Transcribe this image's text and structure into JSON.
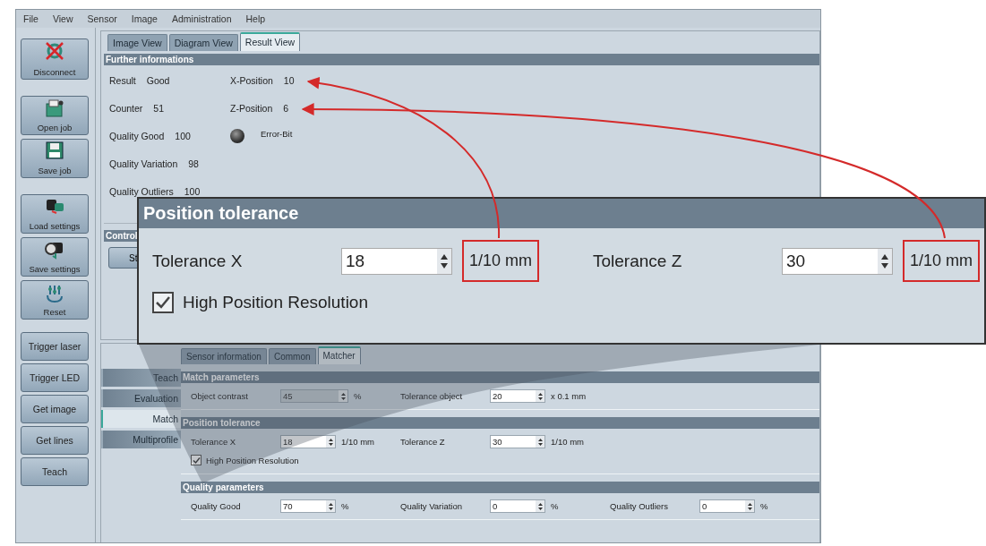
{
  "menu": [
    "File",
    "View",
    "Sensor",
    "Image",
    "Administration",
    "Help"
  ],
  "sidebar": {
    "buttons": [
      {
        "label": "Disconnect",
        "kind": "disconnect"
      },
      {
        "label": "Open job",
        "kind": "open"
      },
      {
        "label": "Save job",
        "kind": "save"
      },
      {
        "label": "Load settings",
        "kind": "load"
      },
      {
        "label": "Save settings",
        "kind": "store"
      },
      {
        "label": "Reset",
        "kind": "reset"
      },
      {
        "label": "Trigger laser",
        "kind": "text"
      },
      {
        "label": "Trigger LED",
        "kind": "text"
      },
      {
        "label": "Get image",
        "kind": "text"
      },
      {
        "label": "Get lines",
        "kind": "text"
      },
      {
        "label": "Teach",
        "kind": "text"
      }
    ]
  },
  "top_tabs": [
    {
      "label": "Image View",
      "selected": false
    },
    {
      "label": "Diagram View",
      "selected": false
    },
    {
      "label": "Result View",
      "selected": true
    }
  ],
  "further_info": {
    "title": "Further informations",
    "left_rows": [
      {
        "label": "Result",
        "value": "Good"
      },
      {
        "label": "Counter",
        "value": "51"
      },
      {
        "label": "Quality Good",
        "value": "100"
      },
      {
        "label": "Quality Variation",
        "value": "98"
      },
      {
        "label": "Quality Outliers",
        "value": "100"
      }
    ],
    "right_rows": [
      {
        "label": "X-Position",
        "value": "10"
      },
      {
        "label": "Z-Position",
        "value": "6"
      }
    ],
    "error_bit": {
      "label": "Error-Bit"
    }
  },
  "control": {
    "title": "Control",
    "button": "St"
  },
  "side_tabs": [
    {
      "label": "Teach",
      "selected": false
    },
    {
      "label": "Evaluation",
      "selected": false
    },
    {
      "label": "Match",
      "selected": true
    },
    {
      "label": "Multiprofile",
      "selected": false
    }
  ],
  "bottom_tabs": [
    {
      "label": "Sensor information",
      "selected": false
    },
    {
      "label": "Common",
      "selected": false
    },
    {
      "label": "Matcher",
      "selected": true
    }
  ],
  "sections": [
    {
      "title": "Match parameters",
      "rows": [
        {
          "kind": "fields",
          "fields": [
            {
              "label": "Object contrast",
              "value": "45",
              "unit": "%",
              "disabled": true
            },
            {
              "label": "Tolerance object",
              "value": "20",
              "unit": "x 0.1 mm",
              "disabled": false
            }
          ]
        }
      ]
    },
    {
      "title": "Position tolerance",
      "rows": [
        {
          "kind": "fields",
          "fields": [
            {
              "label": "Tolerance X",
              "value": "18",
              "unit": "1/10 mm",
              "disabled": false
            },
            {
              "label": "Tolerance Z",
              "value": "30",
              "unit": "1/10 mm",
              "disabled": false
            }
          ]
        },
        {
          "kind": "checkbox",
          "label": "High Position Resolution",
          "checked": true
        }
      ]
    },
    {
      "title": "Quality parameters",
      "rows": [
        {
          "kind": "fields",
          "fields": [
            {
              "label": "Quality Good",
              "value": "70",
              "unit": "%",
              "disabled": false
            },
            {
              "label": "Quality Variation",
              "value": "0",
              "unit": "%",
              "disabled": false
            },
            {
              "label": "Quality Outliers",
              "value": "0",
              "unit": "%",
              "disabled": false
            }
          ]
        }
      ]
    }
  ],
  "callout": {
    "title": "Position tolerance",
    "fields": [
      {
        "label": "Tolerance X",
        "value": "18",
        "unit": "1/10 mm",
        "highlighted": true
      },
      {
        "label": "Tolerance Z",
        "value": "30",
        "unit": "1/10 mm",
        "highlighted": true
      }
    ],
    "checkbox": {
      "label": "High Position Resolution",
      "checked": true
    }
  }
}
